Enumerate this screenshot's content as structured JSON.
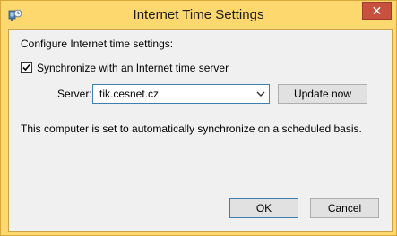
{
  "window": {
    "title": "Internet Time Settings",
    "close_label": "✕"
  },
  "content": {
    "heading": "Configure Internet time settings:",
    "sync_checkbox": {
      "label": "Synchronize with an Internet time server",
      "checked": true
    },
    "server_label": "Server:",
    "server_value": "tik.cesnet.cz",
    "update_button": "Update now",
    "status_text": "This computer is set to automatically synchronize on a scheduled basis."
  },
  "buttons": {
    "ok": "OK",
    "cancel": "Cancel"
  },
  "icons": {
    "title_icon": "clock-globe-icon",
    "combo_arrow": "chevron-down-icon",
    "close": "close-icon"
  },
  "colors": {
    "titlebar": "#fdd86f",
    "close_button": "#c7503f",
    "client_background": "#f0f0f0",
    "focus_border": "#3c7fb1"
  }
}
